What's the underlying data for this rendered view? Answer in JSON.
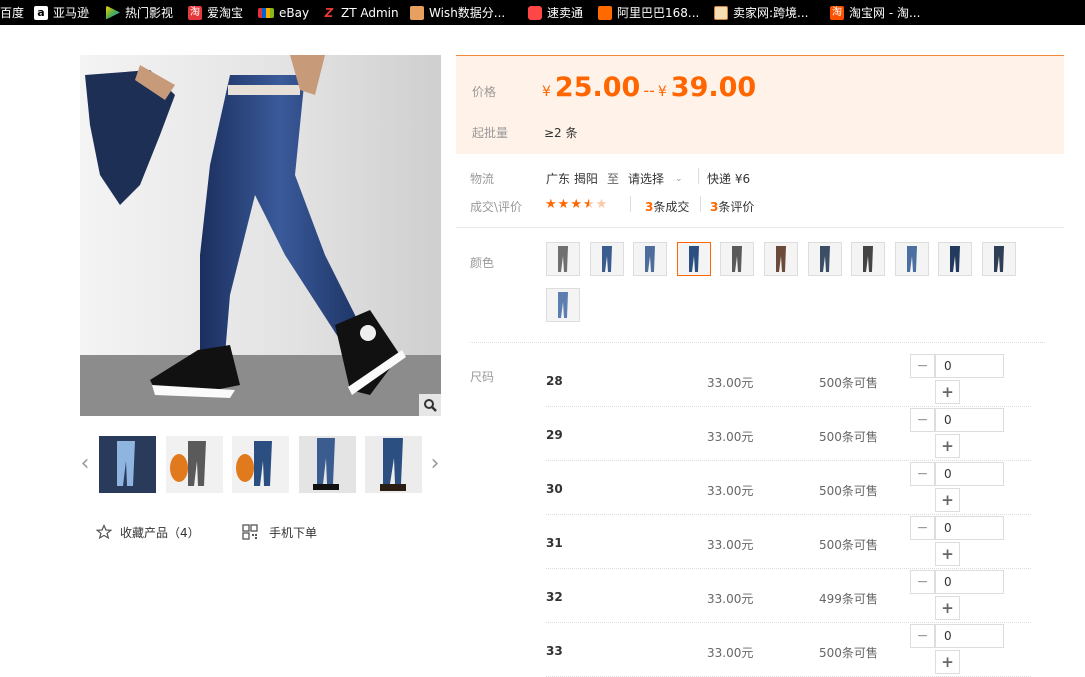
{
  "bookmarks": [
    {
      "label": "百度",
      "icon": "baidu-icon",
      "color": "#2932e1"
    },
    {
      "label": "亚马逊",
      "icon": "amazon-icon",
      "color": "#ffffff"
    },
    {
      "label": "热门影视",
      "icon": "play-icon",
      "color": "#4caf50"
    },
    {
      "label": "爱淘宝",
      "icon": "taobao-icon",
      "color": "#e4393c"
    },
    {
      "label": "eBay",
      "icon": "ebay-icon",
      "color": "#e53238"
    },
    {
      "label": "ZT Admin",
      "icon": "zt-icon",
      "color": "#d32f2f"
    },
    {
      "label": "Wish数据分...",
      "icon": "wish-icon",
      "color": "#f4a460"
    },
    {
      "label": "速卖通",
      "icon": "aliexpress-icon",
      "color": "#ff4747"
    },
    {
      "label": "阿里巴巴168...",
      "icon": "alibaba-icon",
      "color": "#ff6a00"
    },
    {
      "label": "卖家网:跨境...",
      "icon": "seller-icon",
      "color": "#e07020"
    },
    {
      "label": "淘宝网 - 淘...",
      "icon": "taobao2-icon",
      "color": "#ff5000"
    }
  ],
  "gallery": {
    "thumbs": [
      "thumb-light-jeans",
      "thumb-gray-fleece",
      "thumb-blue-fleece",
      "thumb-blue-sneakers",
      "thumb-blue-boots"
    ],
    "favorite_label": "收藏产品（4）",
    "mobile_label": "手机下单"
  },
  "price": {
    "label": "价格",
    "currency": "¥",
    "min": "25.00",
    "sep": "--",
    "max": "39.00",
    "moq_label": "起批量",
    "moq_value": "≥2 条"
  },
  "logistics": {
    "label": "物流",
    "from": "广东 揭阳",
    "to_word": "至",
    "dest": "请选择",
    "shipping": "快递 ¥6"
  },
  "deals": {
    "label": "成交\\评价",
    "rating": 3.5,
    "rating_max": 5,
    "sales_num": "3",
    "sales_unit": "条成交",
    "review_num": "3",
    "review_unit": "条评价"
  },
  "colors": {
    "label": "颜色",
    "swatches": [
      "#707070",
      "#3b5c8f",
      "#4d6e9c",
      "#2c4f82",
      "#5a5a5a",
      "#6a4a3a",
      "#3c4d66",
      "#444444",
      "#4b6fa0",
      "#233a5e",
      "#2e3e56",
      "#5d7fb0"
    ]
  },
  "sizes": {
    "label": "尺码",
    "rows": [
      {
        "size": "28",
        "price": "33.00元",
        "stock": "500条可售",
        "qty": "0"
      },
      {
        "size": "29",
        "price": "33.00元",
        "stock": "500条可售",
        "qty": "0"
      },
      {
        "size": "30",
        "price": "33.00元",
        "stock": "500条可售",
        "qty": "0"
      },
      {
        "size": "31",
        "price": "33.00元",
        "stock": "500条可售",
        "qty": "0"
      },
      {
        "size": "32",
        "price": "33.00元",
        "stock": "499条可售",
        "qty": "0"
      },
      {
        "size": "33",
        "price": "33.00元",
        "stock": "500条可售",
        "qty": "0"
      }
    ]
  },
  "colors_theme": {
    "accent": "#ff6600",
    "price_bg": "#fff2e8"
  }
}
